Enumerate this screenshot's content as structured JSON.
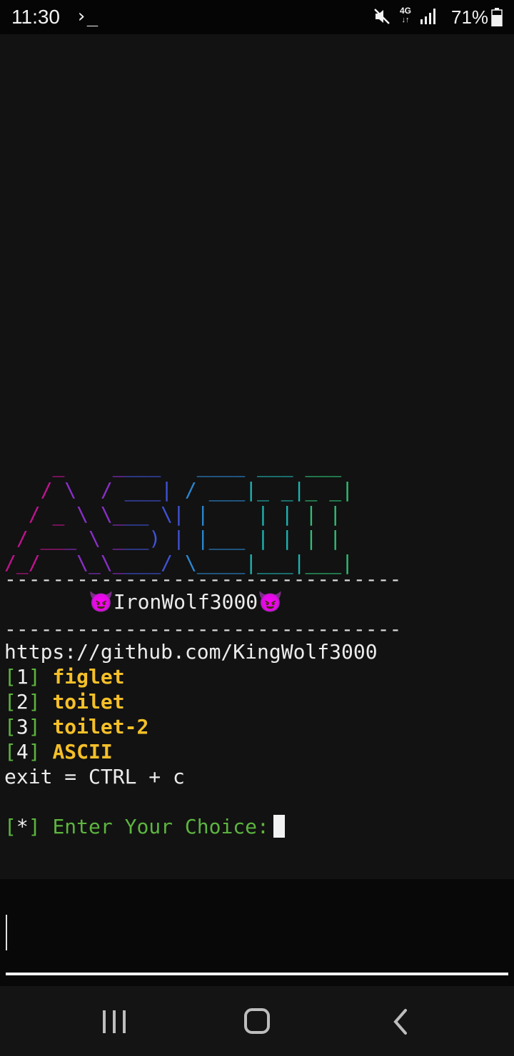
{
  "status_bar": {
    "time": "11:30",
    "terminal_glyph": "›_",
    "network": "4G",
    "battery_percent": "71%",
    "icons": [
      "terminal-notification-icon",
      "mute-icon",
      "network-4g-icon",
      "signal-icon",
      "battery-icon"
    ]
  },
  "terminal": {
    "banner_lines": [
      "    _    ____   ____ ___ ___ ",
      "   / \\  / ___| / ___|_ _|_ _|",
      "  / _ \\ \\___ \\| |    | | | | ",
      " / ___ \\ ___) | |___ | | | | ",
      "/_/   \\_\\____/ \\____|___|___|"
    ],
    "separator": "---------------------------------",
    "author": "😈IronWolf3000😈",
    "url": "https://github.com/KingWolf3000",
    "menu": [
      {
        "num": "1",
        "label": "figlet"
      },
      {
        "num": "2",
        "label": "toilet"
      },
      {
        "num": "3",
        "label": "toilet-2"
      },
      {
        "num": "4",
        "label": "ASCII"
      }
    ],
    "exit_hint": "exit = CTRL + c",
    "prompt": {
      "star": "*",
      "text": "Enter Your Choice:"
    }
  },
  "colors": {
    "background": "#121212",
    "bracket_green": "#5db53f",
    "option_yellow": "#f5c028",
    "banner_gradient": [
      "#c0138f",
      "#8a2fc8",
      "#3f52d6",
      "#2a86cf",
      "#1fb2b0",
      "#2fbf75"
    ]
  },
  "nav_bar": {
    "buttons": [
      "recent-apps",
      "home",
      "back"
    ]
  }
}
